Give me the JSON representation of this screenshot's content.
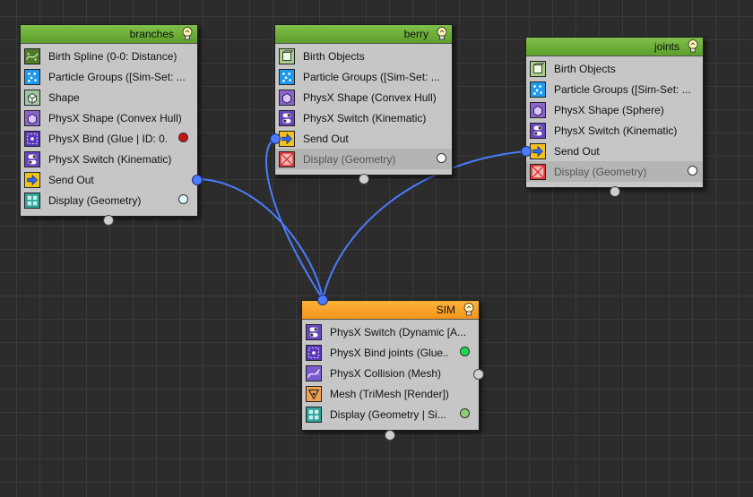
{
  "colors": {
    "background": "#2c2c2c",
    "header_green": "#6aab36",
    "header_orange": "#f9a32a",
    "node_body": "#c6c6c6",
    "wire": "#4a7cff",
    "dot_red": "#cc1111",
    "dot_lightblue": "#dff6ff",
    "dot_white": "#ffffff",
    "dot_green": "#1cdc4a",
    "dot_lightgreen": "#8ccf72"
  },
  "nodes": {
    "branches": {
      "title": "branches",
      "operators": [
        {
          "label": "Birth Spline (0-0: Distance)",
          "icon": "birth-spline-icon"
        },
        {
          "label": "Particle Groups ([Sim-Set: ...",
          "icon": "particle-groups-icon"
        },
        {
          "label": "Shape",
          "icon": "shape-icon"
        },
        {
          "label": "PhysX Shape (Convex Hull)",
          "icon": "physx-shape-icon"
        },
        {
          "label": "PhysX Bind (Glue | ID: 0...",
          "icon": "physx-bind-icon",
          "dot": "red"
        },
        {
          "label": "PhysX Switch (Kinematic)",
          "icon": "physx-switch-icon"
        },
        {
          "label": "Send Out",
          "icon": "send-out-icon"
        },
        {
          "label": "Display (Geometry)",
          "icon": "display-icon",
          "dot": "lightblue"
        }
      ]
    },
    "berry": {
      "title": "berry",
      "operators": [
        {
          "label": "Birth Objects",
          "icon": "birth-objects-icon"
        },
        {
          "label": "Particle Groups ([Sim-Set: ...",
          "icon": "particle-groups-icon"
        },
        {
          "label": "PhysX Shape (Convex Hull)",
          "icon": "physx-shape-icon"
        },
        {
          "label": "PhysX Switch (Kinematic)",
          "icon": "physx-switch-icon"
        },
        {
          "label": "Send Out",
          "icon": "send-out-icon"
        },
        {
          "label": "Display (Geometry)",
          "icon": "display-disabled-icon",
          "dot": "white",
          "disabled": true
        }
      ]
    },
    "joints": {
      "title": "joints",
      "operators": [
        {
          "label": "Birth Objects",
          "icon": "birth-objects-icon"
        },
        {
          "label": "Particle Groups ([Sim-Set: ...",
          "icon": "particle-groups-icon"
        },
        {
          "label": "PhysX Shape (Sphere)",
          "icon": "physx-shape-icon"
        },
        {
          "label": "PhysX Switch (Kinematic)",
          "icon": "physx-switch-icon"
        },
        {
          "label": "Send Out",
          "icon": "send-out-icon"
        },
        {
          "label": "Display (Geometry)",
          "icon": "display-disabled-icon",
          "dot": "white",
          "disabled": true
        }
      ]
    },
    "sim": {
      "title": "SIM",
      "operators": [
        {
          "label": "PhysX Switch (Dynamic [A...",
          "icon": "physx-switch-icon"
        },
        {
          "label": "PhysX Bind joints (Glue...",
          "icon": "physx-bind-icon",
          "dot": "green"
        },
        {
          "label": "PhysX Collision (Mesh)",
          "icon": "physx-collision-icon"
        },
        {
          "label": "Mesh (TriMesh [Render])",
          "icon": "mesh-icon"
        },
        {
          "label": "Display (Geometry | Si...",
          "icon": "display-icon",
          "dot": "lightgreen"
        }
      ]
    }
  }
}
